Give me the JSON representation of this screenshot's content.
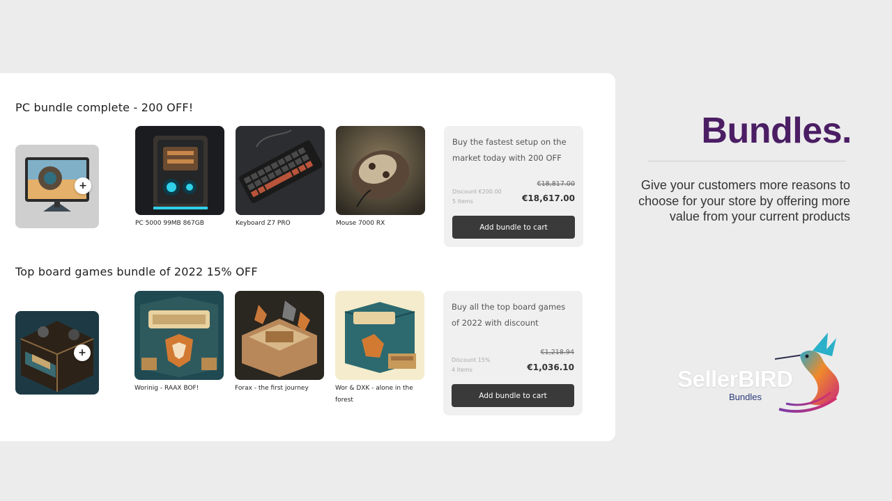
{
  "bundles": [
    {
      "title": "PC bundle complete - 200 OFF!",
      "plus": "+",
      "products": [
        {
          "name": "PC 5000 99MB 867GB"
        },
        {
          "name": "Keyboard Z7 PRO"
        },
        {
          "name": "Mouse 7000 RX"
        }
      ],
      "offer": {
        "description": "Buy the fastest setup on the market today with 200 OFF",
        "discount": "Discount €200.00",
        "items": "5 items",
        "old_price": "€18,817.00",
        "new_price": "€18,617.00",
        "button": "Add bundle to cart"
      }
    },
    {
      "title": "Top board games bundle of 2022 15% OFF",
      "plus": "+",
      "products": [
        {
          "name": "Worinig - RAAX BOF!"
        },
        {
          "name": "Forax - the first journey"
        },
        {
          "name": "Wor & DXK - alone in the forest"
        }
      ],
      "offer": {
        "description": "Buy all the top board games of 2022 with discount",
        "discount": "Discount 15%",
        "items": "4 items",
        "old_price": "€1,218.94",
        "new_price": "€1,036.10",
        "button": "Add bundle to cart"
      }
    }
  ],
  "hero": {
    "title": "Bundles.",
    "text": "Give your customers more reasons to choose for your store by offering more value from your current products"
  },
  "brand": {
    "name": "SellerBIRD",
    "sub": "Bundles"
  },
  "images": {
    "bundle1_main": "monitor-image",
    "pc": "pc-tower-image",
    "keyboard": "keyboard-image",
    "mouse": "mouse-image",
    "bundle2_main": "board-game-box-image",
    "game1": "worinig-box-image",
    "game2": "forax-box-image",
    "game3": "wor-dxk-box-image"
  },
  "colors": {
    "accent": "#4b1e64",
    "button": "#3a3a3a",
    "background": "#ececec"
  }
}
